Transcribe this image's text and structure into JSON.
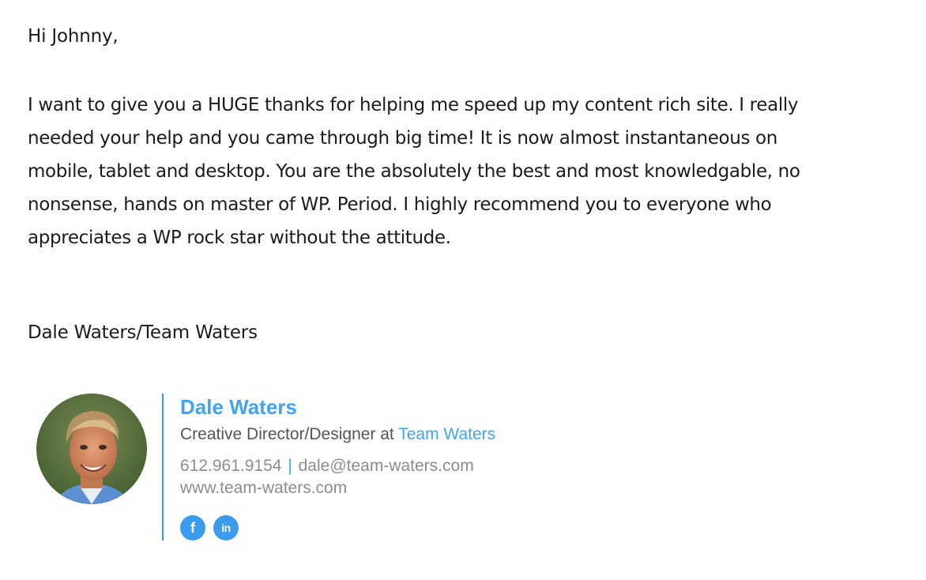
{
  "message": {
    "greeting": "Hi Johnny,",
    "body_lines": [
      "I want to give you a HUGE thanks for helping me speed up my content rich site. I really",
      "needed your help and you came through big time! It is now almost instantaneous on",
      "mobile, tablet and desktop. You are the absolutely the best and most knowledgable, no",
      "nonsense, hands on master of WP. Period. I highly recommend you to everyone who",
      "appreciates a WP rock star without the attitude."
    ],
    "sign_off": "Dale Waters/Team Waters"
  },
  "signature": {
    "name": "Dale Waters",
    "title_prefix": "Creative Director/Designer at ",
    "company": "Team Waters",
    "phone": "612.961.9154",
    "separator": "|",
    "email": "dale@team-waters.com",
    "website": "www.team-waters.com",
    "social": [
      {
        "icon": "facebook-icon",
        "glyph": "f"
      },
      {
        "icon": "linkedin-icon",
        "glyph": "in"
      }
    ],
    "accent_color": "#42a4f0",
    "text_color": "#555555",
    "muted_color": "#8d8d8d"
  }
}
